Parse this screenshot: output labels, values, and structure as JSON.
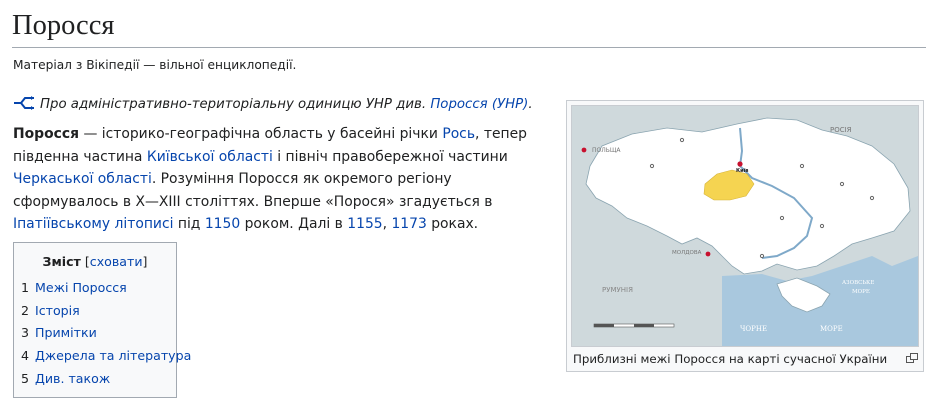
{
  "page": {
    "title": "Поросся",
    "site_sub": "Матеріал з Вікіпедії — вільної енциклопедії."
  },
  "hatnote": {
    "text": "Про адміністративно-територіальну одиницю УНР див. ",
    "link": "Поросся (УНР)",
    "end": "."
  },
  "lead": {
    "bold_term": "Поросся",
    "t1": " —  історико-географічна область у басейні річки ",
    "link_ros": "Рось",
    "t2": ", тепер південна частина ",
    "link_kyiv": "Київської області",
    "t3": " і північ правобережної частини ",
    "link_cherkasy": "Черкаської області",
    "t4": ". Розуміння Поросся як окремого регіону сформувалось в X—XIII століттях. Вперше «Порося» згадується в ",
    "link_ipatiev": "Іпатіївському літописі",
    "t5": " під ",
    "link_1150": "1150",
    "t6": " роком. Далі в ",
    "link_1155": "1155",
    "t7": ", ",
    "link_1173": "1173",
    "t8": " роках."
  },
  "toc": {
    "title": "Зміст",
    "toggle_open": "[",
    "toggle": "сховати",
    "toggle_close": "]",
    "items": [
      {
        "num": "1",
        "label": "Межі Поросся"
      },
      {
        "num": "2",
        "label": "Історія"
      },
      {
        "num": "3",
        "label": "Примітки"
      },
      {
        "num": "4",
        "label": "Джерела та література"
      },
      {
        "num": "5",
        "label": "Див. також"
      }
    ]
  },
  "figure": {
    "caption": "Приблизні межі Поросся на карті сучасної України",
    "map_labels": {
      "poland": "ПОЛЬЩА",
      "russia": "РОСІЯ",
      "moldova": "МОЛДОВА",
      "romania": "РУМУНІЯ",
      "kyiv": "Київ",
      "black_sea_1": "ЧОРНЕ",
      "black_sea_2": "МОРЕ",
      "azov_1": "АЗОВСЬКЕ",
      "azov_2": "МОРЕ"
    }
  },
  "colors": {
    "link": "#0645ad",
    "map_land": "#ffffff",
    "map_outside": "#cfd9dc",
    "map_sea": "#a9c8de",
    "porossia_region": "#f5d451"
  }
}
